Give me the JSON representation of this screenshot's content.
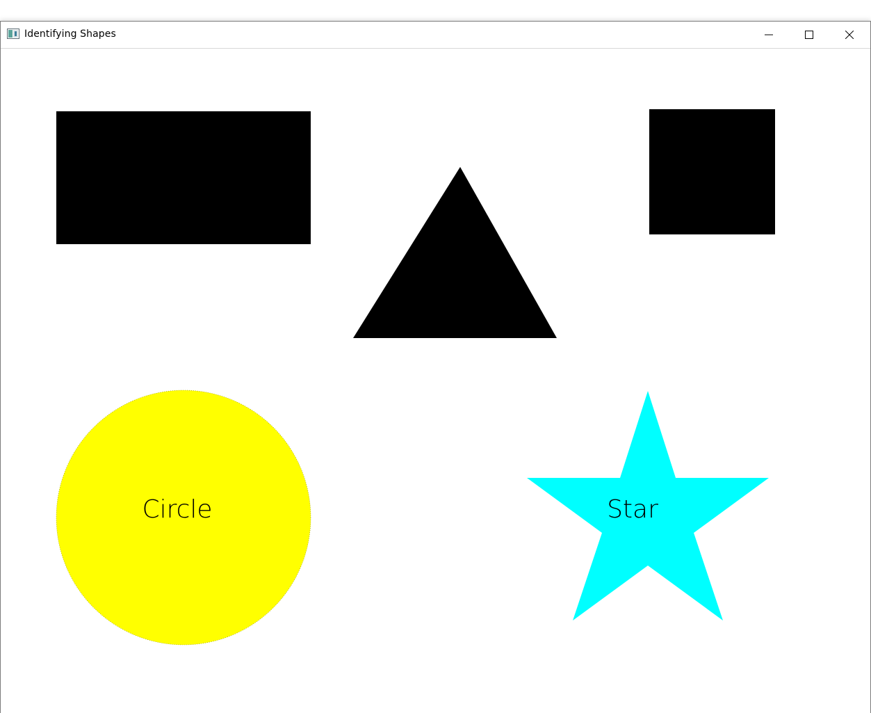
{
  "window": {
    "title": "Identifying Shapes",
    "controls": [
      "minimize",
      "maximize",
      "close"
    ]
  },
  "canvas": {
    "background": "#ffffff",
    "shapes": [
      {
        "kind": "rectangle",
        "color": "#000000",
        "label": ""
      },
      {
        "kind": "triangle",
        "color": "#000000",
        "label": ""
      },
      {
        "kind": "square",
        "color": "#000000",
        "label": ""
      },
      {
        "kind": "circle",
        "color": "#ffff00",
        "label": "Circle"
      },
      {
        "kind": "star",
        "color": "#00ffff",
        "label": "Star"
      }
    ]
  },
  "icons": {
    "app": "app-window-icon",
    "minimize": "minimize-icon",
    "maximize": "maximize-icon",
    "close": "close-icon"
  }
}
